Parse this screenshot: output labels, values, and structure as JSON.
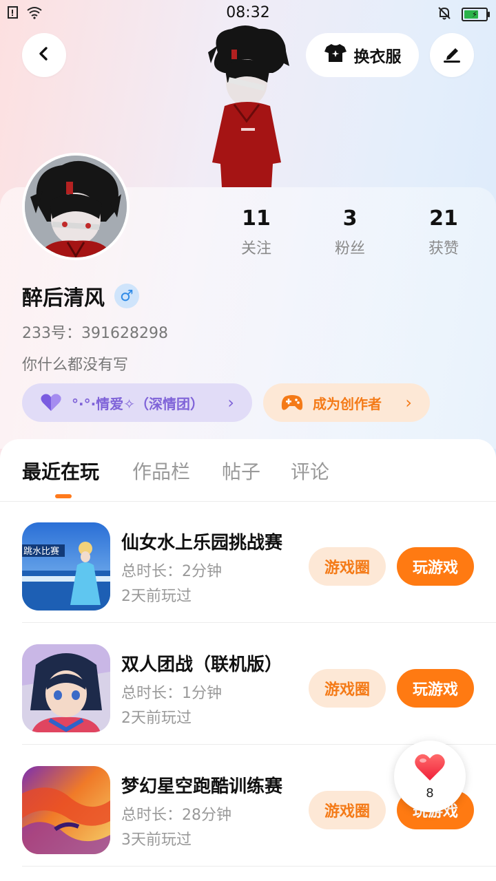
{
  "status_bar": {
    "time": "08:32",
    "icons": [
      "notification-icon",
      "wifi-icon",
      "mute-icon",
      "battery-charging-icon"
    ]
  },
  "header": {
    "back_icon": "back-arrow-icon",
    "dress_up_label": "换衣服",
    "dress_up_icon": "shirt-icon",
    "edit_icon": "edit-pen-icon"
  },
  "profile": {
    "name": "醉后清风",
    "gender_symbol": "♂",
    "uid": "233号：391628298",
    "bio": "你什么都没有写"
  },
  "stats": [
    {
      "value": "11",
      "label": "关注"
    },
    {
      "value": "3",
      "label": "粉丝"
    },
    {
      "value": "21",
      "label": "获赞"
    }
  ],
  "chips": {
    "group_label": "°·°·情爱✧（深情团）",
    "group_icon": "purple-heart-icon",
    "creator_label": "成为创作者",
    "creator_icon": "gamepad-icon",
    "arrow": "›"
  },
  "tabs": [
    {
      "label": "最近在玩",
      "active": true
    },
    {
      "label": "作品栏",
      "active": false
    },
    {
      "label": "帖子",
      "active": false
    },
    {
      "label": "评论",
      "active": false
    }
  ],
  "games": [
    {
      "title": "仙女水上乐园挑战赛",
      "duration": "总时长：2分钟",
      "last_played": "2天前玩过",
      "circle_label": "游戏圈",
      "play_label": "玩游戏",
      "thumb_text": "跳水比赛"
    },
    {
      "title": "双人团战（联机版）",
      "duration": "总时长：1分钟",
      "last_played": "2天前玩过",
      "circle_label": "游戏圈",
      "play_label": "玩游戏"
    },
    {
      "title": "梦幻星空跑酷训练赛",
      "duration": "总时长：28分钟",
      "last_played": "3天前玩过",
      "circle_label": "游戏圈",
      "play_label": "玩游戏"
    }
  ],
  "like_float": {
    "count": "8",
    "icon": "heart-icon"
  },
  "colors": {
    "accent": "#ff7a12",
    "accent_soft": "#fde8d6",
    "purple": "#7f63d8",
    "purple_soft": "#e1dcf7"
  }
}
